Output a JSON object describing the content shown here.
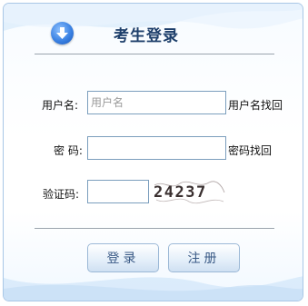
{
  "header": {
    "title": "考生登录",
    "icon": "download-arrow-icon"
  },
  "form": {
    "username_label": "用户名:",
    "username_placeholder": "用户名",
    "username_value": "",
    "find_username_link": "用户名找回",
    "password_label": "密 码:",
    "password_value": "",
    "find_password_link": "密码找回",
    "captcha_label": "验证码:",
    "captcha_value": "",
    "captcha_text": "24237"
  },
  "buttons": {
    "login": "登录",
    "register": "注册"
  },
  "colors": {
    "border": "#a9c7e6",
    "title": "#1e3f6b",
    "button_text": "#3a5a86",
    "icon_blue": "#3b82e3"
  }
}
